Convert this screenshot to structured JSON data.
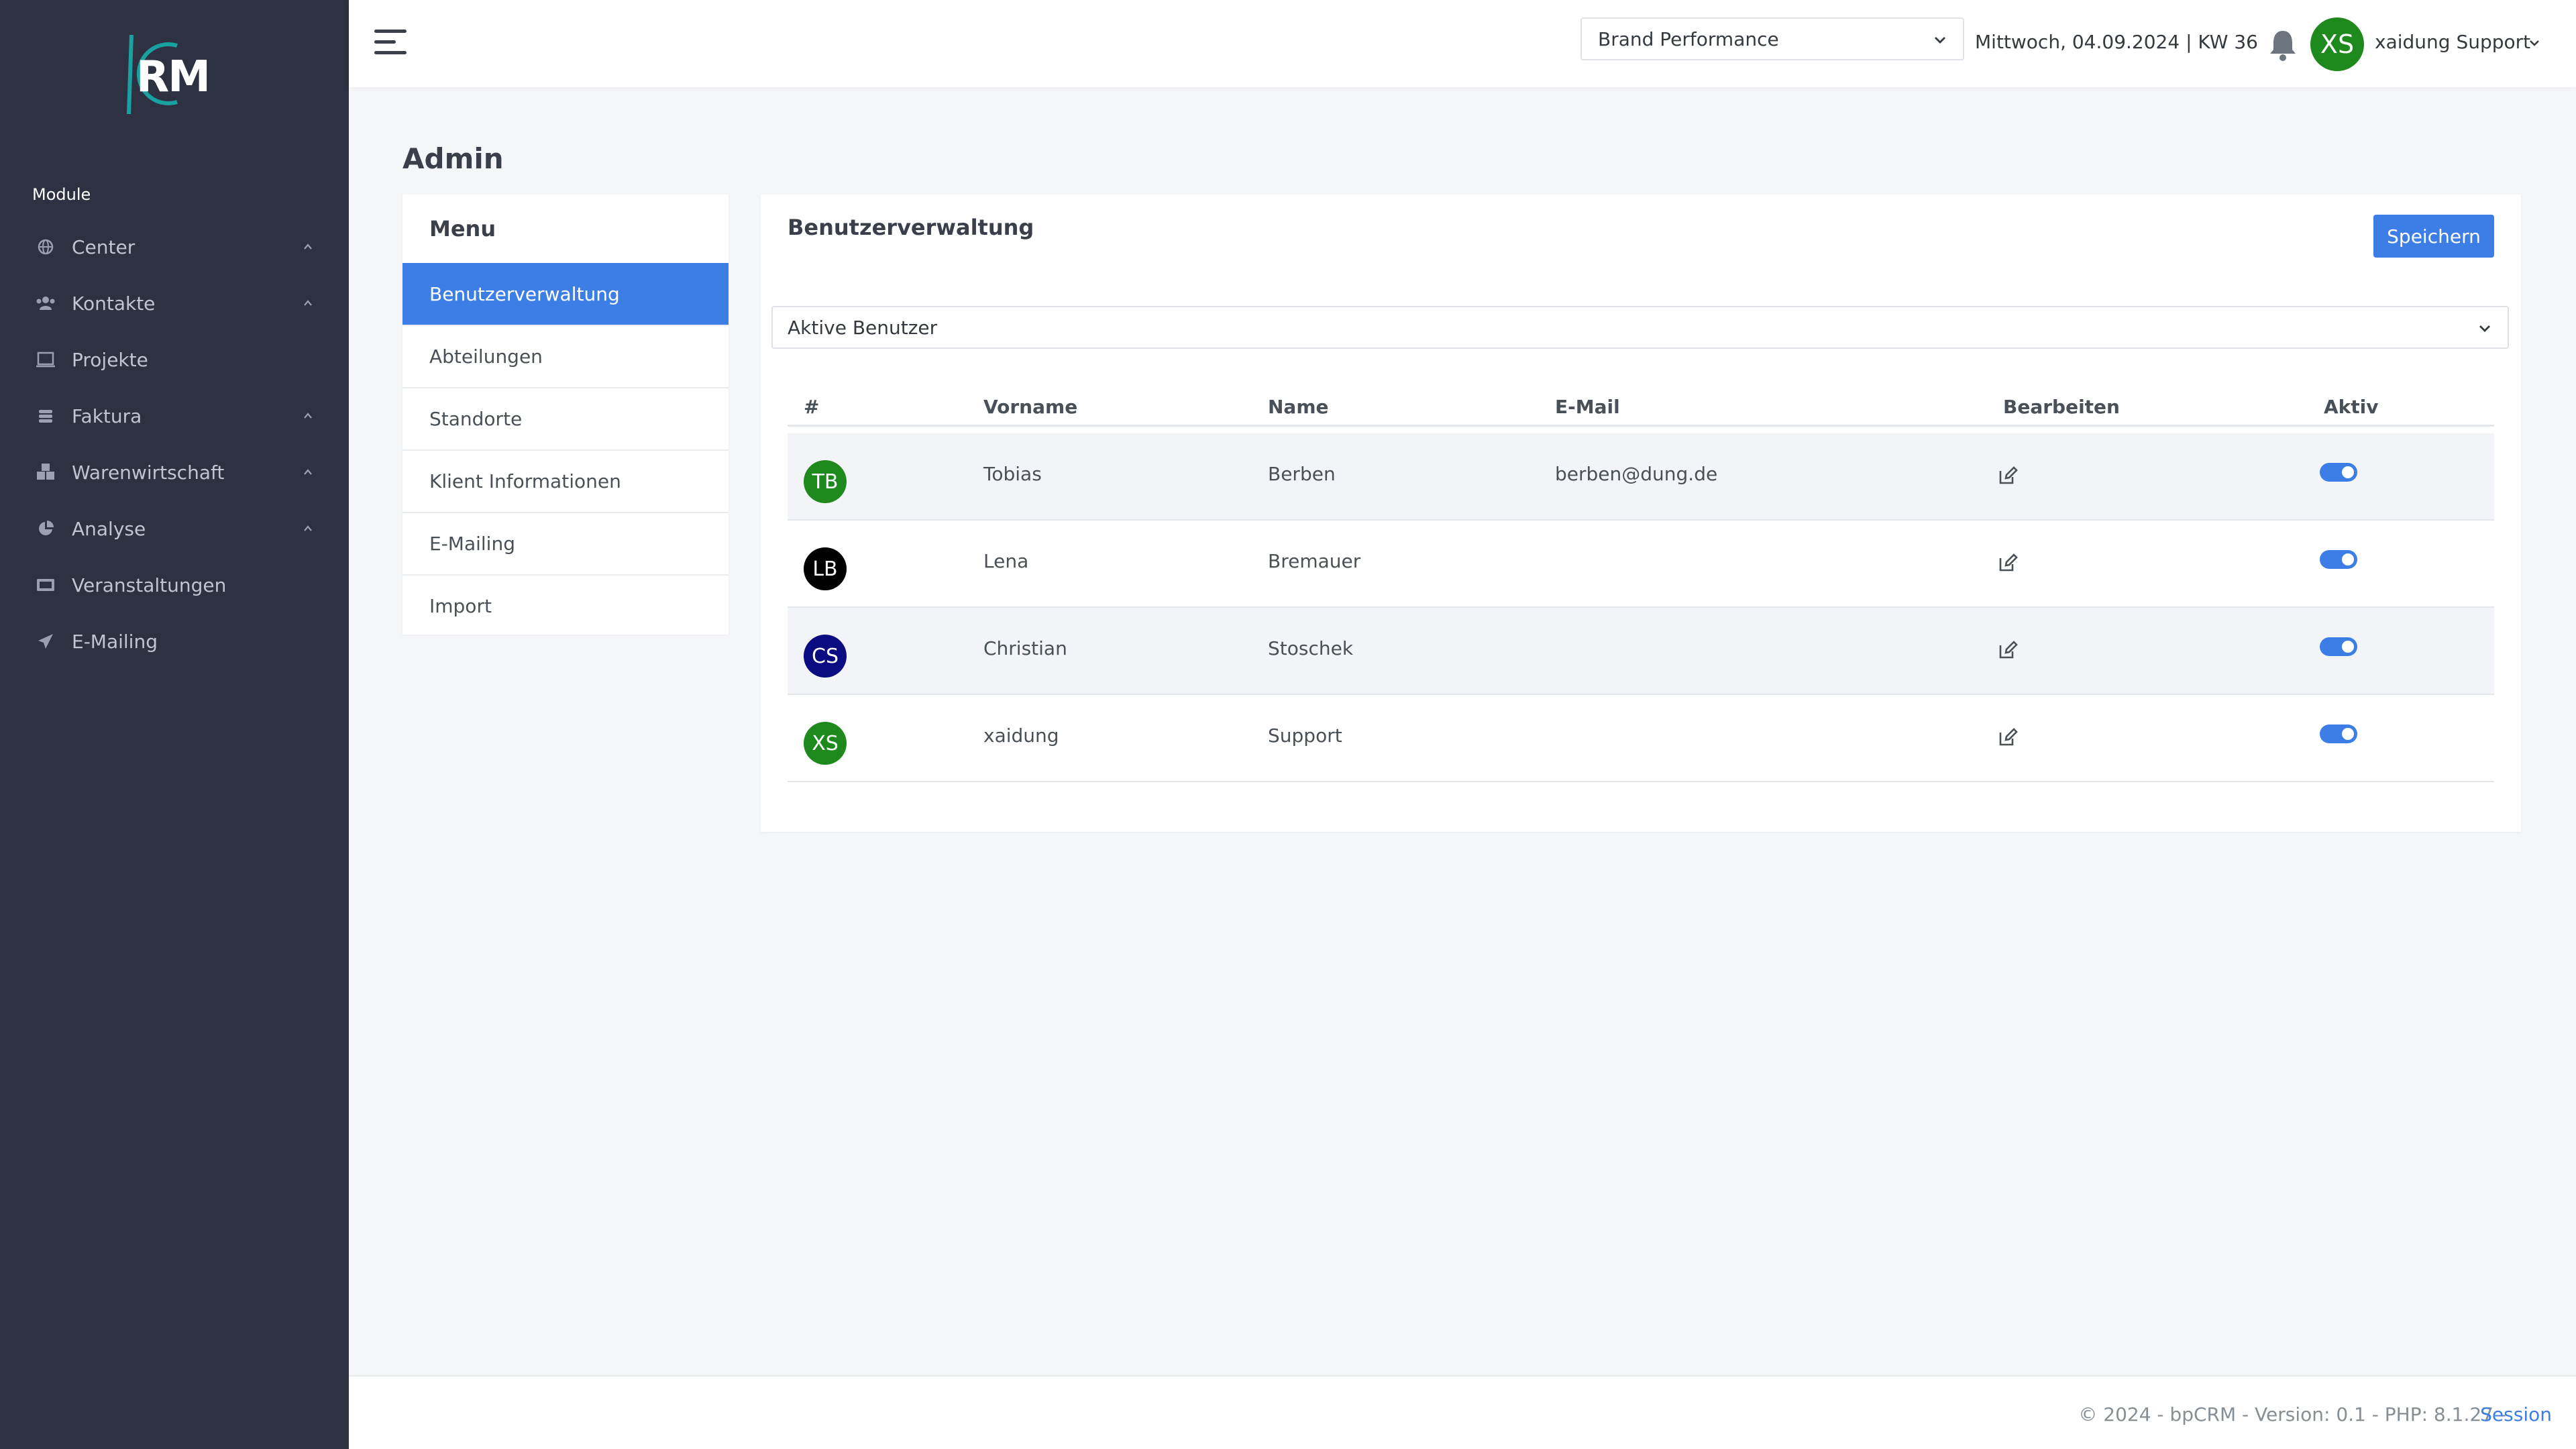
{
  "logo": {
    "text": "RM"
  },
  "sidebar": {
    "section_title": "Module",
    "items": [
      {
        "label": "Center",
        "icon": "globe-icon",
        "has_chevron": true
      },
      {
        "label": "Kontakte",
        "icon": "users-icon",
        "has_chevron": true
      },
      {
        "label": "Projekte",
        "icon": "project-icon",
        "has_chevron": false
      },
      {
        "label": "Faktura",
        "icon": "coins-icon",
        "has_chevron": true
      },
      {
        "label": "Warenwirtschaft",
        "icon": "boxes-icon",
        "has_chevron": true
      },
      {
        "label": "Analyse",
        "icon": "pie-chart-icon",
        "has_chevron": true
      },
      {
        "label": "Veranstaltungen",
        "icon": "ticket-icon",
        "has_chevron": false
      },
      {
        "label": "E-Mailing",
        "icon": "paper-plane-icon",
        "has_chevron": false
      }
    ]
  },
  "header": {
    "brand_select": "Brand Performance",
    "date": "Mittwoch, 04.09.2024 | KW 36",
    "user_initials": "XS",
    "user_name": "xaidung Support"
  },
  "page": {
    "title": "Admin"
  },
  "admin_menu": {
    "title": "Menu",
    "items": [
      {
        "label": "Benutzerverwaltung",
        "active": true
      },
      {
        "label": "Abteilungen",
        "active": false
      },
      {
        "label": "Standorte",
        "active": false
      },
      {
        "label": "Klient Informationen",
        "active": false
      },
      {
        "label": "E-Mailing",
        "active": false
      },
      {
        "label": "Import",
        "active": false
      }
    ]
  },
  "users_panel": {
    "title": "Benutzerverwaltung",
    "save_label": "Speichern",
    "filter": "Aktive Benutzer",
    "columns": [
      "#",
      "Vorname",
      "Name",
      "E-Mail",
      "Bearbeiten",
      "Aktiv"
    ],
    "rows": [
      {
        "initials": "TB",
        "avatar_color": "#1e8a1e",
        "vorname": "Tobias",
        "name": "Berben",
        "email": "berben@dung.de",
        "aktiv": true
      },
      {
        "initials": "LB",
        "avatar_color": "#000000",
        "vorname": "Lena",
        "name": "Bremauer",
        "email": "",
        "aktiv": true
      },
      {
        "initials": "CS",
        "avatar_color": "#0b0b82",
        "vorname": "Christian",
        "name": "Stoschek",
        "email": "",
        "aktiv": true
      },
      {
        "initials": "XS",
        "avatar_color": "#1e8a1e",
        "vorname": "xaidung",
        "name": "Support",
        "email": "",
        "aktiv": true
      }
    ]
  },
  "footer": {
    "text": "© 2024 - bpCRM - Version: 0.1 - PHP: 8.1.27 -",
    "link": "Session"
  },
  "colors": {
    "sidebar_bg": "#2d3142",
    "accent": "#3c7ee6",
    "logo_teal": "#19a1a1"
  }
}
